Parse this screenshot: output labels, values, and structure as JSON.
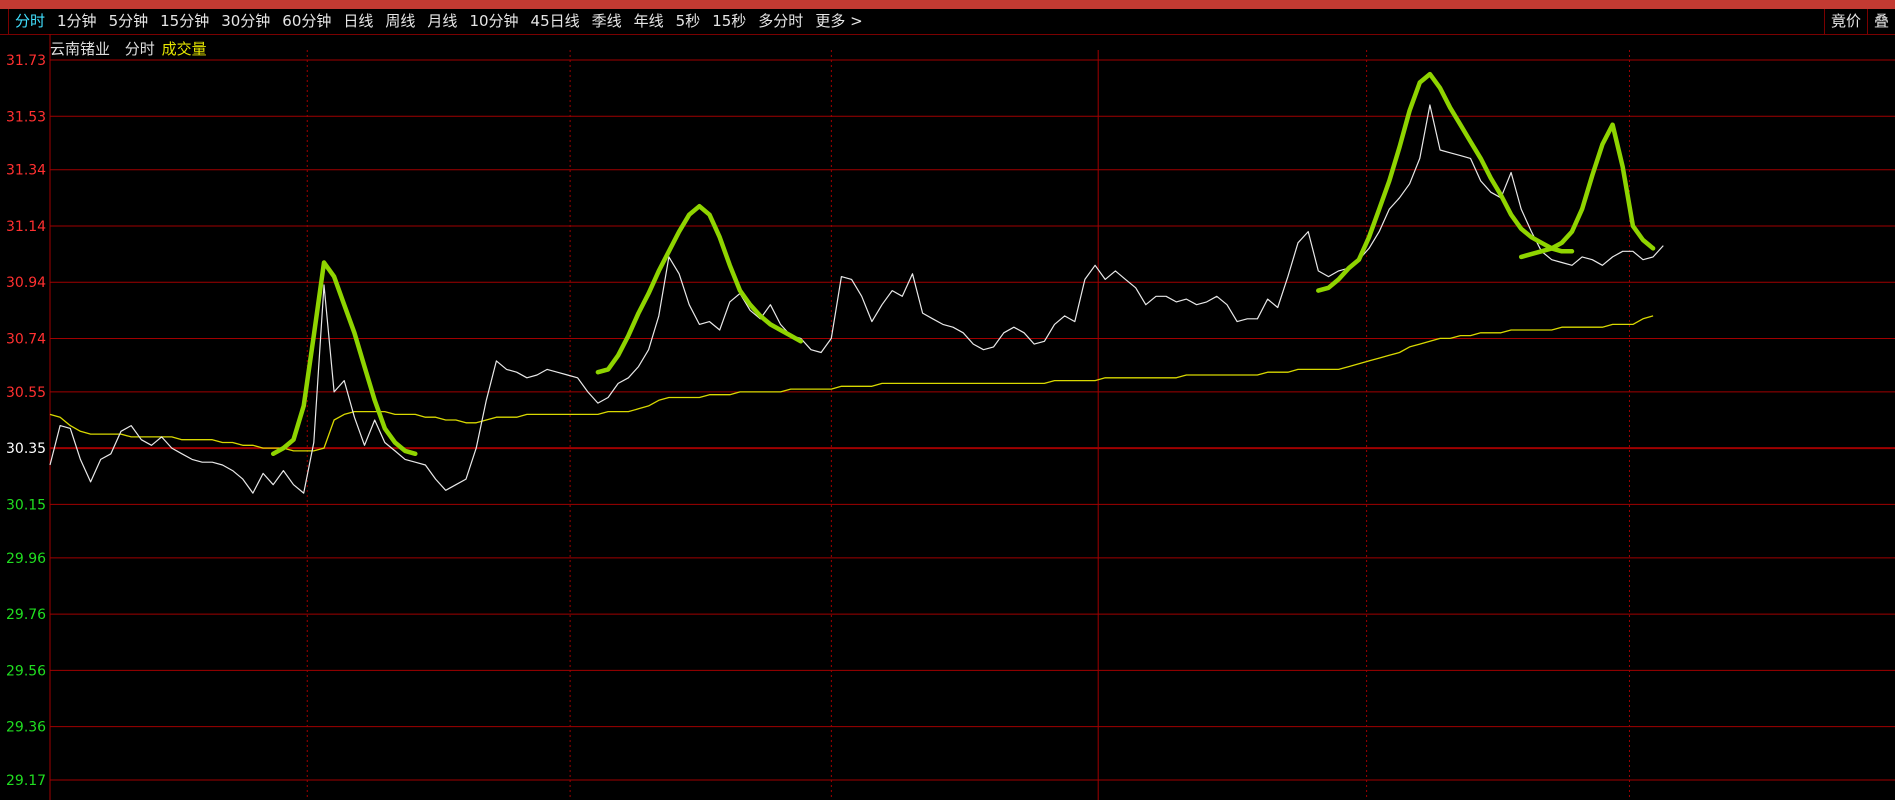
{
  "toolbar": {
    "tabs": [
      "分时",
      "1分钟",
      "5分钟",
      "15分钟",
      "30分钟",
      "60分钟",
      "日线",
      "周线",
      "月线",
      "10分钟",
      "45日线",
      "季线",
      "年线",
      "5秒",
      "15秒",
      "多分时",
      "更多 >"
    ],
    "active_tab": "分时",
    "right": [
      "竟价",
      "叠"
    ]
  },
  "legend": {
    "stock_name": "云南锗业",
    "mode": "分时",
    "series_volume": "成交量"
  },
  "colors": {
    "price_line": "#e8e8e8",
    "avg_line": "#d8d800",
    "grid": "#a00000",
    "up_axis": "#ff3030",
    "down_axis": "#20dd20",
    "ref_axis": "#ffffff",
    "annotation": "#8fd400"
  },
  "chart_data": {
    "type": "line",
    "ylim": [
      29.17,
      31.73
    ],
    "reference_price": 30.35,
    "y_ticks": [
      "31.73",
      "31.53",
      "31.34",
      "31.14",
      "30.94",
      "30.74",
      "30.55",
      "30.35",
      "30.15",
      "29.96",
      "29.76",
      "29.56",
      "29.36",
      "29.17"
    ],
    "x_count": 240,
    "x_visible": 158,
    "series": [
      {
        "values": [
          30.29,
          30.43,
          30.42,
          30.31,
          30.23,
          30.31,
          30.33,
          30.41,
          30.43,
          30.38,
          30.36,
          30.39,
          30.35,
          30.33,
          30.31,
          30.3,
          30.3,
          30.29,
          30.27,
          30.24,
          30.19,
          30.26,
          30.22,
          30.27,
          30.22,
          30.19,
          30.37,
          30.93,
          30.55,
          30.59,
          30.46,
          30.36,
          30.45,
          30.37,
          30.34,
          30.31,
          30.3,
          30.29,
          30.24,
          30.2,
          30.22,
          30.24,
          30.35,
          30.52,
          30.66,
          30.63,
          30.62,
          30.6,
          30.61,
          30.63,
          30.62,
          30.61,
          30.6,
          30.55,
          30.51,
          30.53,
          30.58,
          30.6,
          30.64,
          30.7,
          30.82,
          31.03,
          30.97,
          30.86,
          30.79,
          30.8,
          30.77,
          30.87,
          30.9,
          30.84,
          30.81,
          30.86,
          30.79,
          30.75,
          30.74,
          30.7,
          30.69,
          30.74,
          30.96,
          30.95,
          30.89,
          30.8,
          30.86,
          30.91,
          30.89,
          30.97,
          30.83,
          30.81,
          30.79,
          30.78,
          30.76,
          30.72,
          30.7,
          30.71,
          30.76,
          30.78,
          30.76,
          30.72,
          30.73,
          30.79,
          30.82,
          30.8,
          30.95,
          31.0,
          30.95,
          30.98,
          30.95,
          30.92,
          30.86,
          30.89,
          30.89,
          30.87,
          30.88,
          30.86,
          30.87,
          30.89,
          30.86,
          30.8,
          30.81,
          30.81,
          30.88,
          30.85,
          30.96,
          31.08,
          31.12,
          30.98,
          30.96,
          30.98,
          30.99,
          31.02,
          31.06,
          31.12,
          31.2,
          31.24,
          31.29,
          31.38,
          31.57,
          31.41,
          31.4,
          31.39,
          31.38,
          31.3,
          31.26,
          31.24,
          31.33,
          31.2,
          31.12,
          31.05,
          31.02,
          31.01,
          31.0,
          31.03,
          31.02,
          31.0,
          31.03,
          31.05,
          31.05,
          31.02,
          31.03,
          31.07
        ],
        "note": "price"
      },
      {
        "values": [
          30.47,
          30.46,
          30.43,
          30.41,
          30.4,
          30.4,
          30.4,
          30.4,
          30.39,
          30.39,
          30.39,
          30.39,
          30.39,
          30.38,
          30.38,
          30.38,
          30.38,
          30.37,
          30.37,
          30.36,
          30.36,
          30.35,
          30.35,
          30.35,
          30.34,
          30.34,
          30.34,
          30.35,
          30.45,
          30.47,
          30.48,
          30.48,
          30.48,
          30.48,
          30.47,
          30.47,
          30.47,
          30.46,
          30.46,
          30.45,
          30.45,
          30.44,
          30.44,
          30.45,
          30.46,
          30.46,
          30.46,
          30.47,
          30.47,
          30.47,
          30.47,
          30.47,
          30.47,
          30.47,
          30.47,
          30.48,
          30.48,
          30.48,
          30.49,
          30.5,
          30.52,
          30.53,
          30.53,
          30.53,
          30.53,
          30.54,
          30.54,
          30.54,
          30.55,
          30.55,
          30.55,
          30.55,
          30.55,
          30.56,
          30.56,
          30.56,
          30.56,
          30.56,
          30.57,
          30.57,
          30.57,
          30.57,
          30.58,
          30.58,
          30.58,
          30.58,
          30.58,
          30.58,
          30.58,
          30.58,
          30.58,
          30.58,
          30.58,
          30.58,
          30.58,
          30.58,
          30.58,
          30.58,
          30.58,
          30.59,
          30.59,
          30.59,
          30.59,
          30.59,
          30.6,
          30.6,
          30.6,
          30.6,
          30.6,
          30.6,
          30.6,
          30.6,
          30.61,
          30.61,
          30.61,
          30.61,
          30.61,
          30.61,
          30.61,
          30.61,
          30.62,
          30.62,
          30.62,
          30.63,
          30.63,
          30.63,
          30.63,
          30.63,
          30.64,
          30.65,
          30.66,
          30.67,
          30.68,
          30.69,
          30.71,
          30.72,
          30.73,
          30.74,
          30.74,
          30.75,
          30.75,
          30.76,
          30.76,
          30.76,
          30.77,
          30.77,
          30.77,
          30.77,
          30.77,
          30.78,
          30.78,
          30.78,
          30.78,
          30.78,
          30.79,
          30.79,
          30.79,
          30.81,
          30.82
        ],
        "note": "average"
      }
    ],
    "annotations": [
      [
        [
          22,
          30.33
        ],
        [
          23,
          30.35
        ],
        [
          24,
          30.38
        ],
        [
          25,
          30.5
        ],
        [
          26,
          30.75
        ],
        [
          27,
          31.01
        ],
        [
          28,
          30.96
        ],
        [
          29,
          30.86
        ],
        [
          30,
          30.76
        ],
        [
          31,
          30.64
        ],
        [
          32,
          30.52
        ],
        [
          33,
          30.42
        ],
        [
          34,
          30.37
        ],
        [
          35,
          30.34
        ],
        [
          36,
          30.33
        ]
      ],
      [
        [
          54,
          30.62
        ],
        [
          55,
          30.63
        ],
        [
          56,
          30.68
        ],
        [
          57,
          30.75
        ],
        [
          58,
          30.83
        ],
        [
          59,
          30.9
        ],
        [
          60,
          30.98
        ],
        [
          61,
          31.05
        ],
        [
          62,
          31.12
        ],
        [
          63,
          31.18
        ],
        [
          64,
          31.21
        ],
        [
          65,
          31.18
        ],
        [
          66,
          31.1
        ],
        [
          67,
          31.0
        ],
        [
          68,
          30.91
        ],
        [
          69,
          30.86
        ],
        [
          70,
          30.82
        ],
        [
          71,
          30.79
        ],
        [
          72,
          30.77
        ],
        [
          73,
          30.75
        ],
        [
          74,
          30.73
        ]
      ],
      [
        [
          125,
          30.91
        ],
        [
          126,
          30.92
        ],
        [
          127,
          30.95
        ],
        [
          128,
          30.99
        ],
        [
          129,
          31.02
        ],
        [
          130,
          31.1
        ],
        [
          131,
          31.2
        ],
        [
          132,
          31.3
        ],
        [
          133,
          31.42
        ],
        [
          134,
          31.55
        ],
        [
          135,
          31.65
        ],
        [
          136,
          31.68
        ],
        [
          137,
          31.63
        ],
        [
          138,
          31.56
        ],
        [
          139,
          31.5
        ],
        [
          140,
          31.44
        ],
        [
          141,
          31.38
        ],
        [
          142,
          31.31
        ],
        [
          143,
          31.25
        ],
        [
          144,
          31.18
        ],
        [
          145,
          31.13
        ],
        [
          146,
          31.1
        ],
        [
          147,
          31.08
        ],
        [
          148,
          31.06
        ],
        [
          149,
          31.05
        ],
        [
          150,
          31.05
        ]
      ],
      [
        [
          145,
          31.03
        ],
        [
          146,
          31.04
        ],
        [
          147,
          31.05
        ],
        [
          148,
          31.06
        ],
        [
          149,
          31.08
        ],
        [
          150,
          31.12
        ],
        [
          151,
          31.2
        ],
        [
          152,
          31.32
        ],
        [
          153,
          31.43
        ],
        [
          154,
          31.5
        ],
        [
          155,
          31.35
        ],
        [
          156,
          31.14
        ],
        [
          157,
          31.09
        ],
        [
          158,
          31.06
        ]
      ]
    ]
  }
}
